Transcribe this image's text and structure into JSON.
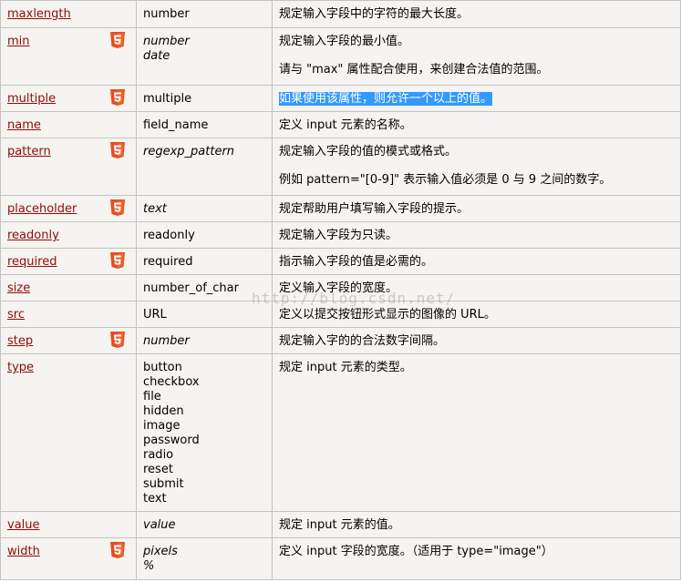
{
  "rows": [
    {
      "attr": "maxlength",
      "html5": false,
      "italic": false,
      "values": [
        "number"
      ],
      "desc": [
        "规定输入字段中的字符的最大长度。"
      ]
    },
    {
      "attr": "min",
      "html5": true,
      "italic": true,
      "values": [
        "number",
        "date"
      ],
      "desc": [
        "规定输入字段的最小值。",
        "请与 \"max\" 属性配合使用，来创建合法值的范围。"
      ]
    },
    {
      "attr": "multiple",
      "html5": true,
      "italic": false,
      "values": [
        "multiple"
      ],
      "desc": [
        "如果使用该属性，则允许一个以上的值。"
      ],
      "highlight": true
    },
    {
      "attr": "name",
      "html5": false,
      "italic": false,
      "values": [
        "field_name"
      ],
      "desc": [
        "定义 input 元素的名称。"
      ]
    },
    {
      "attr": "pattern",
      "html5": true,
      "italic": true,
      "values": [
        "regexp_pattern"
      ],
      "desc": [
        "规定输入字段的值的模式或格式。",
        "例如 pattern=\"[0-9]\" 表示输入值必须是 0 与 9 之间的数字。"
      ]
    },
    {
      "attr": "placeholder",
      "html5": true,
      "italic": true,
      "values": [
        "text"
      ],
      "desc": [
        "规定帮助用户填写输入字段的提示。"
      ]
    },
    {
      "attr": "readonly",
      "html5": false,
      "italic": false,
      "values": [
        "readonly"
      ],
      "desc": [
        "规定输入字段为只读。"
      ]
    },
    {
      "attr": "required",
      "html5": true,
      "italic": false,
      "values": [
        "required"
      ],
      "desc": [
        "指示输入字段的值是必需的。"
      ]
    },
    {
      "attr": "size",
      "html5": false,
      "italic": false,
      "values": [
        "number_of_char"
      ],
      "desc": [
        "定义输入字段的宽度。"
      ]
    },
    {
      "attr": "src",
      "html5": false,
      "italic": false,
      "values": [
        "URL"
      ],
      "desc": [
        "定义以提交按钮形式显示的图像的 URL。"
      ]
    },
    {
      "attr": "step",
      "html5": true,
      "italic": true,
      "values": [
        "number"
      ],
      "desc": [
        "规定输入字的的合法数字间隔。"
      ]
    },
    {
      "attr": "type",
      "html5": false,
      "italic": false,
      "values": [
        "button",
        "checkbox",
        "file",
        "hidden",
        "image",
        "password",
        "radio",
        "reset",
        "submit",
        "text"
      ],
      "desc": [
        "规定 input 元素的类型。"
      ]
    },
    {
      "attr": "value",
      "html5": false,
      "italic": true,
      "values": [
        "value"
      ],
      "desc": [
        "规定 input 元素的值。"
      ]
    },
    {
      "attr": "width",
      "html5": true,
      "italic": true,
      "values": [
        "pixels",
        "%"
      ],
      "desc": [
        "定义 input 字段的宽度。（适用于 type=\"image\"）"
      ]
    }
  ],
  "watermark": "http://blog.csdn.net/",
  "colors": {
    "link": "#900b09",
    "cell_bg": "#f6f4f0",
    "border": "#c3c3c3",
    "html5_badge": "#e44d26",
    "highlight": "#3399ff"
  },
  "icons": {
    "html5_badge": "html5-icon"
  }
}
